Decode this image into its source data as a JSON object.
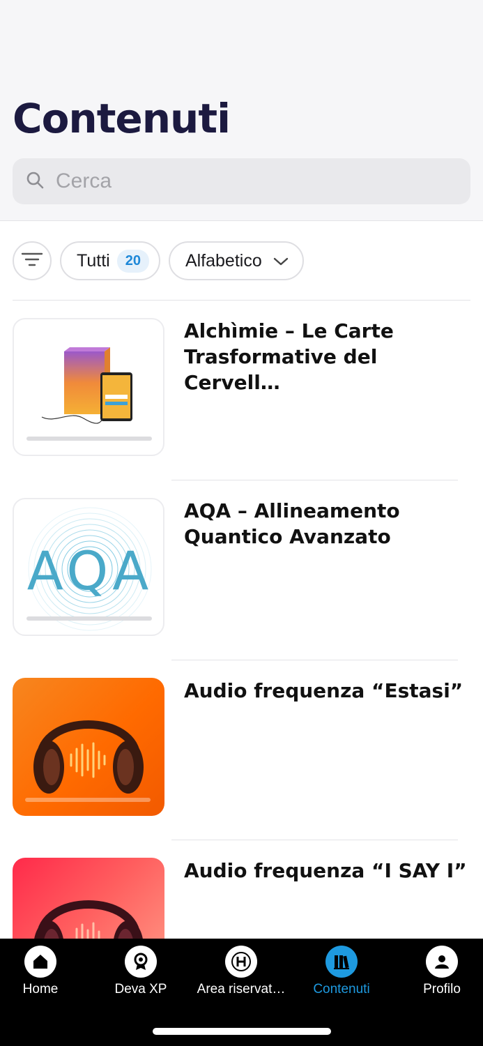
{
  "header": {
    "title": "Contenuti"
  },
  "search": {
    "placeholder": "Cerca",
    "icon": "search-icon"
  },
  "filters": {
    "filter_icon": "filter-icon",
    "all_label": "Tutti",
    "all_count": "20",
    "sort_label": "Alfabetico",
    "sort_icon": "chevron-down-icon"
  },
  "items": [
    {
      "title": "Alchìmie – Le Carte Trasformative del Cervell…"
    },
    {
      "title": "AQA – Allineamento Quantico Avanzato",
      "thumb_text": "AQA"
    },
    {
      "title": "Audio frequenza “Estasi”"
    },
    {
      "title": "Audio frequenza “I SAY I”"
    }
  ],
  "tabbar": {
    "items": [
      {
        "label": "Home",
        "icon": "home-icon"
      },
      {
        "label": "Deva XP",
        "icon": "badge-icon"
      },
      {
        "label": "Area riservat…",
        "icon": "h-letter-icon"
      },
      {
        "label": "Contenuti",
        "icon": "books-icon",
        "active": true
      },
      {
        "label": "Profilo",
        "icon": "user-icon"
      }
    ]
  },
  "colors": {
    "title": "#1c1a40",
    "accent": "#1e9ae0",
    "tabbar_bg": "#000000"
  }
}
